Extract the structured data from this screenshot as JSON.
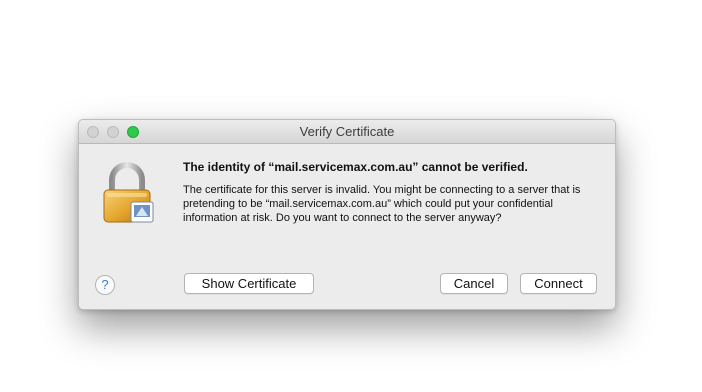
{
  "window": {
    "title": "Verify Certificate"
  },
  "dialog": {
    "heading": "The identity of “mail.servicemax.com.au” cannot be verified.",
    "message": "The certificate for this server is invalid. You might be connecting to a server that is pretending to be “mail.servicemax.com.au” which could put your confidential information at risk. Do you want to connect to the server anyway?",
    "icon": "lock-icon"
  },
  "buttons": {
    "help": "?",
    "show_certificate": "Show Certificate",
    "cancel": "Cancel",
    "connect": "Connect"
  },
  "colors": {
    "zoom_button": "#2fc94b",
    "lock_gold": "#e4a52d",
    "help_accent": "#3d7bdc"
  }
}
